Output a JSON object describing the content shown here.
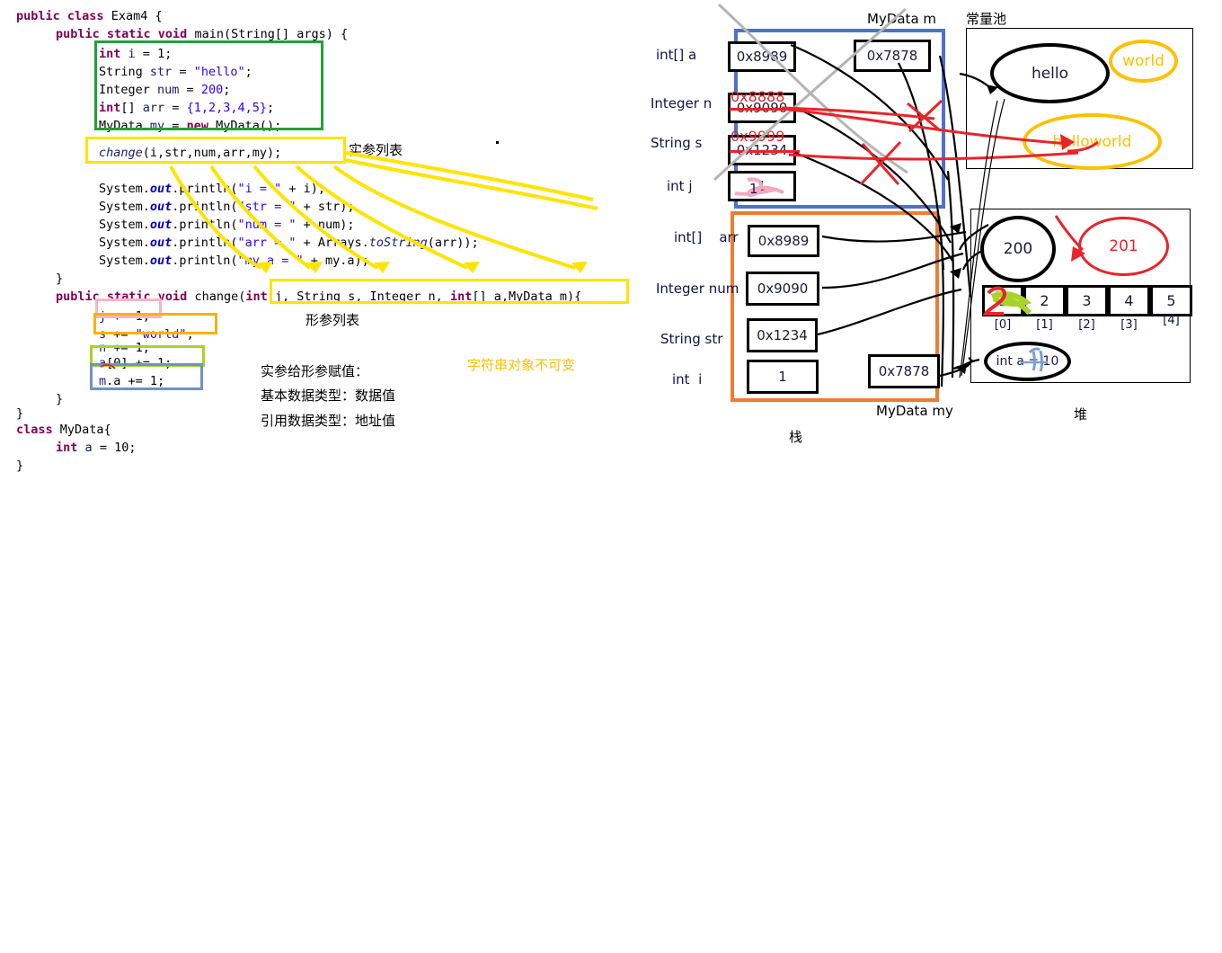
{
  "code": {
    "language": "java",
    "lines": [
      "public class Exam4 {",
      "    public static void main(String[] args) {",
      "        int i = 1;",
      "        String str = \"hello\";",
      "        Integer num = 200;",
      "        int[] arr = {1,2,3,4,5};",
      "        MyData my = new MyData();",
      "",
      "        change(i,str,num,arr,my);",
      "",
      "        System.out.println(\"i = \" + i);",
      "        System.out.println(\"str = \" + str);",
      "        System.out.println(\"num = \" + num);",
      "        System.out.println(\"arr = \" + Arrays.toString(arr));",
      "        System.out.println(\"my.a = \" + my.a);",
      "    }",
      "    public static void change(int j, String s, Integer n, int[] a,MyData m){",
      "        j += 1;",
      "        s += \"world\";",
      "        n += 1;",
      "        a[0] += 1;",
      "        m.a += 1;",
      "    }",
      "}",
      "class MyData{",
      "    int a = 10;",
      "}"
    ]
  },
  "annotations": {
    "actual_param_list": "实参列表",
    "formal_param_list": "形参列表",
    "assign_title": "实参给形参赋值：",
    "assign_primitive": "基本数据类型：数据值",
    "assign_reference": "引用数据类型：地址值",
    "string_immutable": "字符串对象不可变"
  },
  "highlight_colors": {
    "green": "#21a038",
    "yellow": "#ffe400",
    "pink": "#f9b3c8",
    "orange": "#ffb000",
    "lime": "#a8d32a",
    "blue": "#6e93c0",
    "frame_blue": "#4f6fd0",
    "frame_orange": "#ed7d31",
    "gold": "#ffc000",
    "red": "#e8242a"
  },
  "diagram": {
    "stack": {
      "caption": "栈",
      "change_frame": {
        "title": "MyData m",
        "border_color": "#4f6fd0",
        "slots": [
          {
            "label": "int[] a",
            "value": "0x8989",
            "overwritten": null,
            "old": null
          },
          {
            "label": "Integer n",
            "value": "0x9090",
            "overwritten": "0x8888",
            "old": "0x9090"
          },
          {
            "label": "String s",
            "value": "0x1234",
            "overwritten": "0x9999",
            "old": "0x1234"
          },
          {
            "label": "int j",
            "value": "1",
            "overwritten": "2",
            "old": "1"
          }
        ],
        "extra_slot": {
          "label": "MyData m",
          "value": "0x7878"
        }
      },
      "main_frame": {
        "title": "MyData my",
        "border_color": "#ed7d31",
        "slots": [
          {
            "label": "int[]    arr",
            "value": "0x8989"
          },
          {
            "label": "Integer num",
            "value": "0x9090"
          },
          {
            "label": "String str",
            "value": "0x1234"
          },
          {
            "label": "int  i",
            "value": "1"
          }
        ],
        "extra_slot": {
          "label": "MyData my",
          "value": "0x7878"
        }
      }
    },
    "constant_pool": {
      "caption": "常量池",
      "items": [
        {
          "text": "hello",
          "color": "#000000"
        },
        {
          "text": "world",
          "color": "#ffc000"
        },
        {
          "text": "helloworld",
          "color": "#ffc000"
        }
      ]
    },
    "heap": {
      "caption": "堆",
      "integer_objects": [
        {
          "text": "200",
          "color": "#000000"
        },
        {
          "text": "201",
          "color": "#e8242a"
        }
      ],
      "array": {
        "values": [
          "1",
          "2",
          "3",
          "4",
          "5"
        ],
        "indices": [
          "[0]",
          "[1]",
          "[2]",
          "[3]",
          "[4]"
        ],
        "cell0_overwritten": "2"
      },
      "mydata_object": {
        "text": "int a = 10",
        "overwritten": "11"
      }
    }
  }
}
